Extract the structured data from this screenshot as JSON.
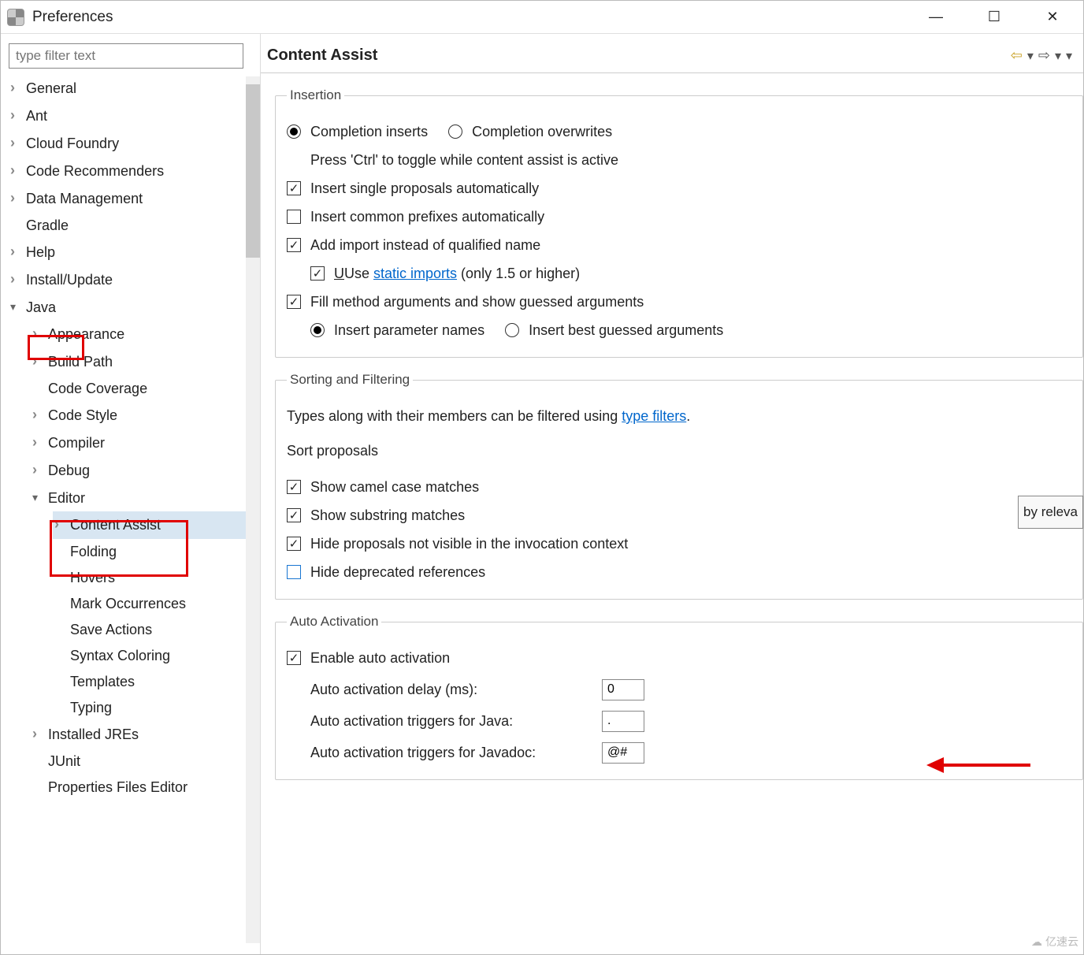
{
  "title": "Preferences",
  "filter_placeholder": "type filter text",
  "tree": {
    "general": "General",
    "ant": "Ant",
    "cloudfoundry": "Cloud Foundry",
    "coderec": "Code Recommenders",
    "datamgmt": "Data Management",
    "gradle": "Gradle",
    "help": "Help",
    "installupdate": "Install/Update",
    "java": "Java",
    "appearance": "Appearance",
    "buildpath": "Build Path",
    "codecoverage": "Code Coverage",
    "codestyle": "Code Style",
    "compiler": "Compiler",
    "debug": "Debug",
    "editor": "Editor",
    "contentassist": "Content Assist",
    "folding": "Folding",
    "hovers": "Hovers",
    "markocc": "Mark Occurrences",
    "saveactions": "Save Actions",
    "syntax": "Syntax Coloring",
    "templates": "Templates",
    "typing": "Typing",
    "installedjres": "Installed JREs",
    "junit": "JUnit",
    "propfiles": "Properties Files Editor"
  },
  "content": {
    "heading": "Content Assist",
    "insertion_legend": "Insertion",
    "completion_inserts": "Completion inserts",
    "completion_overwrites": "Completion overwrites",
    "ctrl_hint": "Press 'Ctrl' to toggle while content assist is active",
    "insert_single": "Insert single proposals automatically",
    "insert_common": "Insert common prefixes automatically",
    "add_import": "Add import instead of qualified name",
    "use_static_pre": "Use ",
    "use_static_link": "static imports",
    "use_static_post": " (only 1.5 or higher)",
    "fill_method": "Fill method arguments and show guessed arguments",
    "insert_param": "Insert parameter names",
    "insert_best": "Insert best guessed arguments",
    "sorting_legend": "Sorting and Filtering",
    "types_filter_pre": "Types along with their members can be filtered using ",
    "types_filter_link": "type filters",
    "types_filter_post": ".",
    "sort_proposals": "Sort proposals",
    "sort_value": "by releva",
    "show_camel": "Show camel case matches",
    "show_substring": "Show substring matches",
    "hide_invisible": "Hide proposals not visible in the invocation context",
    "hide_deprecated": "Hide deprecated references",
    "auto_legend": "Auto Activation",
    "enable_auto": "Enable auto activation",
    "delay_label": "Auto activation delay (ms):",
    "delay_value": "0",
    "triggers_java_label": "Auto activation triggers for Java:",
    "triggers_java_value": ".",
    "triggers_doc_label": "Auto activation triggers for Javadoc:",
    "triggers_doc_value": "@#"
  },
  "watermark": "亿速云"
}
